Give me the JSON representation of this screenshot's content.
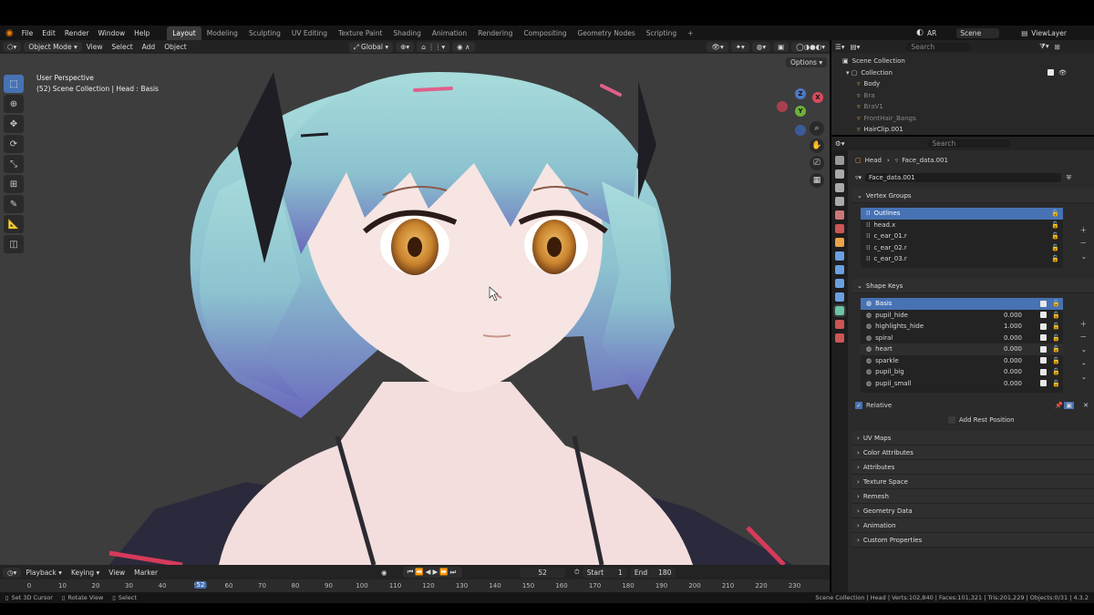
{
  "topbar": {
    "menus": [
      "File",
      "Edit",
      "Render",
      "Window",
      "Help"
    ],
    "workspaces": [
      "Layout",
      "Modeling",
      "Sculpting",
      "UV Editing",
      "Texture Paint",
      "Shading",
      "Animation",
      "Rendering",
      "Compositing",
      "Geometry Nodes",
      "Scripting"
    ],
    "active_workspace": "Layout",
    "add_tab": "+",
    "scene_label": "AR",
    "scene": "Scene",
    "search_placeholder": "Search",
    "view_layer": "ViewLayer"
  },
  "viewport_header": {
    "mode": "Object Mode",
    "menus": [
      "View",
      "Select",
      "Add",
      "Object"
    ],
    "orientation": "Global",
    "options": "Options"
  },
  "viewport": {
    "perspective": "User Perspective",
    "collection_info": "(52) Scene Collection | Head : Basis",
    "gizmo": {
      "x": "X",
      "y": "Y",
      "z": "Z"
    }
  },
  "outliner": {
    "root": "Scene Collection",
    "collection": "Collection",
    "items": [
      "Body",
      "Bra",
      "BraV1",
      "FrontHair_Bangs",
      "HairClip.001"
    ]
  },
  "properties": {
    "search_placeholder": "Search",
    "breadcrumb_object": "Head",
    "breadcrumb_data": "Face_data.001",
    "data_name": "Face_data.001",
    "vertex_groups": {
      "title": "Vertex Groups",
      "items": [
        "Outlines",
        "head.x",
        "c_ear_01.r",
        "c_ear_02.r",
        "c_ear_03.r"
      ]
    },
    "shape_keys": {
      "title": "Shape Keys",
      "items": [
        {
          "name": "Basis",
          "value": ""
        },
        {
          "name": "pupil_hide",
          "value": "0.000"
        },
        {
          "name": "highlights_hide",
          "value": "1.000"
        },
        {
          "name": "spiral",
          "value": "0.000"
        },
        {
          "name": "heart",
          "value": "0.000"
        },
        {
          "name": "sparkle",
          "value": "0.000"
        },
        {
          "name": "pupil_big",
          "value": "0.000"
        },
        {
          "name": "pupil_small",
          "value": "0.000"
        }
      ]
    },
    "relative": "Relative",
    "add_rest_position": "Add Rest Position",
    "panels": [
      "UV Maps",
      "Color Attributes",
      "Attributes",
      "Texture Space",
      "Remesh",
      "Geometry Data",
      "Animation",
      "Custom Properties"
    ]
  },
  "timeline": {
    "menus": [
      "Playback",
      "Keying",
      "View",
      "Marker"
    ],
    "current_frame": "52",
    "start_label": "Start",
    "start": "1",
    "end_label": "End",
    "end": "180",
    "ticks": [
      "0",
      "10",
      "20",
      "30",
      "40",
      "5",
      "60",
      "70",
      "80",
      "90",
      "100",
      "110",
      "120",
      "130",
      "140",
      "150",
      "160",
      "170",
      "180",
      "190",
      "200",
      "210",
      "220",
      "230"
    ]
  },
  "statusbar": {
    "left": [
      "Set 3D Cursor",
      "Rotate View",
      "Select"
    ],
    "right": "Scene Collection | Head | Verts:102,840 | Faces:101,321 | Tris:201,229 | Objects:0/31 | 4.3.2"
  },
  "colors": {
    "accent": "#4772b3",
    "hair_top": "#9ed8da",
    "hair_bottom": "#6a6cc0",
    "skin": "#f6e3e1",
    "background": "#3d3d3d"
  }
}
